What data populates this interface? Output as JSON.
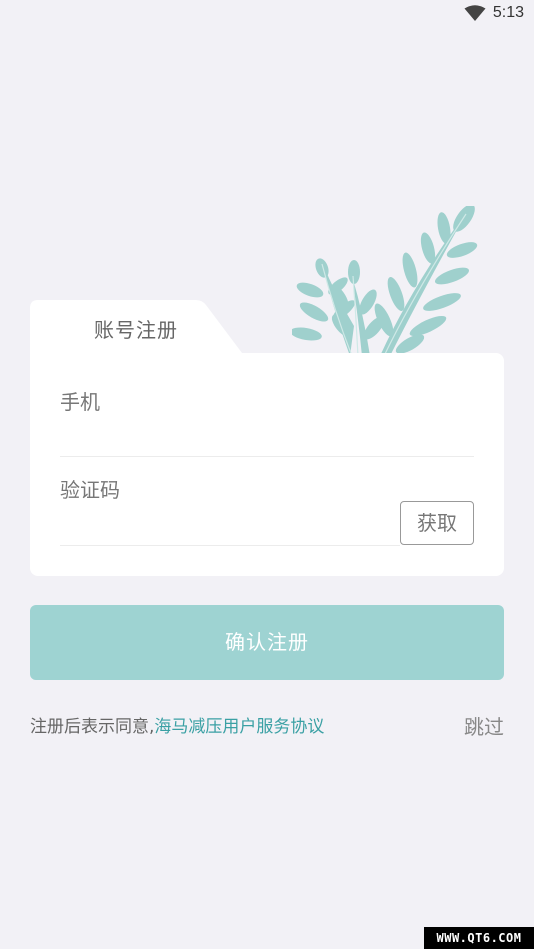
{
  "status_bar": {
    "time": "5:13",
    "wifi_icon": "wifi-icon"
  },
  "card": {
    "tab_title": "账号注册",
    "phone_label": "手机",
    "phone_value": "",
    "code_label": "验证码",
    "code_value": "",
    "get_code_label": "获取"
  },
  "confirm_label": "确认注册",
  "agreement": {
    "prefix": "注册后表示同意,",
    "link_text": "海马减压用户服务协议"
  },
  "skip_label": "跳过",
  "watermark": "WWW.QT6.COM",
  "colors": {
    "background": "#f2f1f6",
    "accent": "#9ed3d2",
    "link": "#3aa0a4",
    "leaf": "#9fd0cd"
  }
}
